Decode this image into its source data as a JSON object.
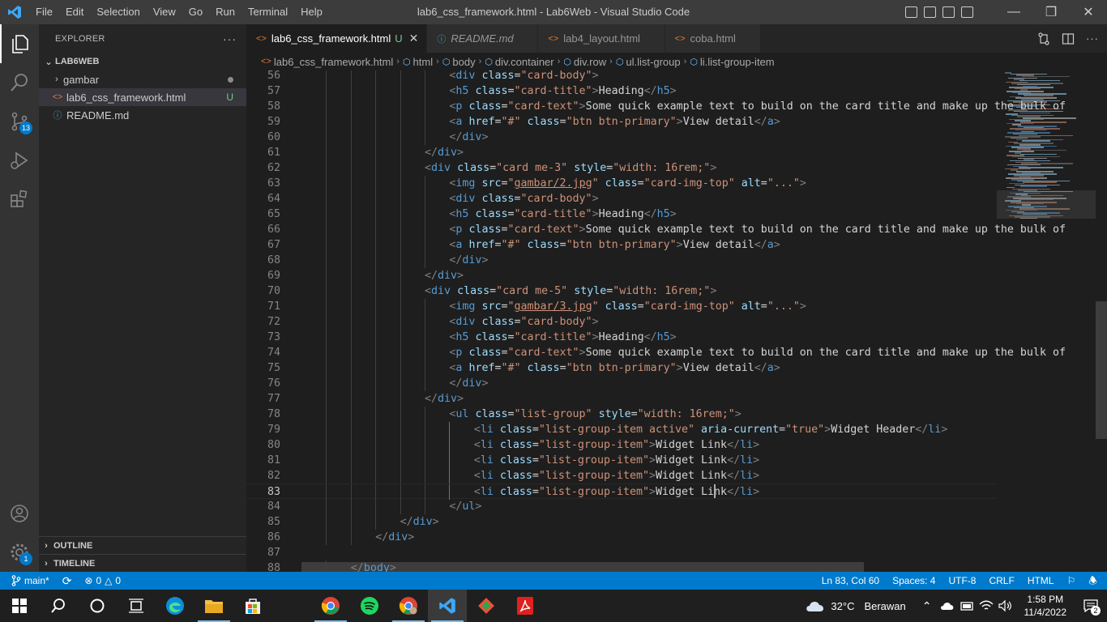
{
  "titlebar": {
    "menu": [
      "File",
      "Edit",
      "Selection",
      "View",
      "Go",
      "Run",
      "Terminal",
      "Help"
    ],
    "title": "lab6_css_framework.html - Lab6Web - Visual Studio Code"
  },
  "activitybar": {
    "source_control_badge": "13",
    "settings_badge": "1"
  },
  "sidebar": {
    "header": "EXPLORER",
    "folder": "LAB6WEB",
    "items": [
      {
        "label": "gambar",
        "type": "folder",
        "status": "dot"
      },
      {
        "label": "lab6_css_framework.html",
        "type": "html",
        "status": "U"
      },
      {
        "label": "README.md",
        "type": "info",
        "status": ""
      }
    ],
    "outline": "OUTLINE",
    "timeline": "TIMELINE"
  },
  "tabs": [
    {
      "label": "lab6_css_framework.html",
      "status": "U",
      "active": true,
      "icon": "html-icon"
    },
    {
      "label": "README.md",
      "status": "",
      "active": false,
      "icon": "info-icon"
    },
    {
      "label": "lab4_layout.html",
      "status": "",
      "active": false,
      "icon": "html-icon"
    },
    {
      "label": "coba.html",
      "status": "",
      "active": false,
      "icon": "html-icon"
    }
  ],
  "breadcrumb": [
    "lab6_css_framework.html",
    "html",
    "body",
    "div.container",
    "div.row",
    "ul.list-group",
    "li.list-group-item"
  ],
  "editor": {
    "current_line": 83,
    "lines": [
      {
        "n": "56",
        "indent": 6,
        "html": "<span class='tg'>&lt;</span><span class='tn'>div</span> <span class='at'>class</span><span class='tx'>=</span><span class='st'>\"card-body\"</span><span class='tg'>&gt;</span>"
      },
      {
        "n": "57",
        "indent": 6,
        "html": "<span class='tg'>&lt;</span><span class='tn'>h5</span> <span class='at'>class</span><span class='tx'>=</span><span class='st'>\"card-title\"</span><span class='tg'>&gt;</span><span class='tx'>Heading</span><span class='tg'>&lt;/</span><span class='tn'>h5</span><span class='tg'>&gt;</span>"
      },
      {
        "n": "58",
        "indent": 6,
        "html": "<span class='tg'>&lt;</span><span class='tn'>p</span> <span class='at'>class</span><span class='tx'>=</span><span class='st'>\"card-text\"</span><span class='tg'>&gt;</span><span class='tx'>Some quick example text to build on the card title and make up the bulk of</span>"
      },
      {
        "n": "59",
        "indent": 6,
        "html": "<span class='tg'>&lt;</span><span class='tn'>a</span> <span class='at'>href</span><span class='tx'>=</span><span class='st'>\"#\"</span> <span class='at'>class</span><span class='tx'>=</span><span class='st'>\"btn btn-primary\"</span><span class='tg'>&gt;</span><span class='tx'>View detail</span><span class='tg'>&lt;/</span><span class='tn'>a</span><span class='tg'>&gt;</span>"
      },
      {
        "n": "60",
        "indent": 6,
        "html": "<span class='tg'>&lt;/</span><span class='tn'>div</span><span class='tg'>&gt;</span>"
      },
      {
        "n": "61",
        "indent": 5,
        "html": "<span class='tg'>&lt;/</span><span class='tn'>div</span><span class='tg'>&gt;</span>"
      },
      {
        "n": "62",
        "indent": 5,
        "html": "<span class='tg'>&lt;</span><span class='tn'>div</span> <span class='at'>class</span><span class='tx'>=</span><span class='st'>\"card me-3\"</span> <span class='at'>style</span><span class='tx'>=</span><span class='st'>\"width: 16rem;\"</span><span class='tg'>&gt;</span>"
      },
      {
        "n": "63",
        "indent": 6,
        "html": "<span class='tg'>&lt;</span><span class='tn'>img</span> <span class='at'>src</span><span class='tx'>=</span><span class='st'>\"<span class='ul'>gambar/2.jpg</span>\"</span> <span class='at'>class</span><span class='tx'>=</span><span class='st'>\"card-img-top\"</span> <span class='at'>alt</span><span class='tx'>=</span><span class='st'>\"...\"</span><span class='tg'>&gt;</span>"
      },
      {
        "n": "64",
        "indent": 6,
        "html": "<span class='tg'>&lt;</span><span class='tn'>div</span> <span class='at'>class</span><span class='tx'>=</span><span class='st'>\"card-body\"</span><span class='tg'>&gt;</span>"
      },
      {
        "n": "65",
        "indent": 6,
        "html": "<span class='tg'>&lt;</span><span class='tn'>h5</span> <span class='at'>class</span><span class='tx'>=</span><span class='st'>\"card-title\"</span><span class='tg'>&gt;</span><span class='tx'>Heading</span><span class='tg'>&lt;/</span><span class='tn'>h5</span><span class='tg'>&gt;</span>"
      },
      {
        "n": "66",
        "indent": 6,
        "html": "<span class='tg'>&lt;</span><span class='tn'>p</span> <span class='at'>class</span><span class='tx'>=</span><span class='st'>\"card-text\"</span><span class='tg'>&gt;</span><span class='tx'>Some quick example text to build on the card title and make up the bulk of</span>"
      },
      {
        "n": "67",
        "indent": 6,
        "html": "<span class='tg'>&lt;</span><span class='tn'>a</span> <span class='at'>href</span><span class='tx'>=</span><span class='st'>\"#\"</span> <span class='at'>class</span><span class='tx'>=</span><span class='st'>\"btn btn-primary\"</span><span class='tg'>&gt;</span><span class='tx'>View detail</span><span class='tg'>&lt;/</span><span class='tn'>a</span><span class='tg'>&gt;</span>"
      },
      {
        "n": "68",
        "indent": 6,
        "html": "<span class='tg'>&lt;/</span><span class='tn'>div</span><span class='tg'>&gt;</span>"
      },
      {
        "n": "69",
        "indent": 5,
        "html": "<span class='tg'>&lt;/</span><span class='tn'>div</span><span class='tg'>&gt;</span>"
      },
      {
        "n": "70",
        "indent": 5,
        "html": "<span class='tg'>&lt;</span><span class='tn'>div</span> <span class='at'>class</span><span class='tx'>=</span><span class='st'>\"card me-5\"</span> <span class='at'>style</span><span class='tx'>=</span><span class='st'>\"width: 16rem;\"</span><span class='tg'>&gt;</span>"
      },
      {
        "n": "71",
        "indent": 6,
        "html": "<span class='tg'>&lt;</span><span class='tn'>img</span> <span class='at'>src</span><span class='tx'>=</span><span class='st'>\"<span class='ul'>gambar/3.jpg</span>\"</span> <span class='at'>class</span><span class='tx'>=</span><span class='st'>\"card-img-top\"</span> <span class='at'>alt</span><span class='tx'>=</span><span class='st'>\"...\"</span><span class='tg'>&gt;</span>"
      },
      {
        "n": "72",
        "indent": 6,
        "html": "<span class='tg'>&lt;</span><span class='tn'>div</span> <span class='at'>class</span><span class='tx'>=</span><span class='st'>\"card-body\"</span><span class='tg'>&gt;</span>"
      },
      {
        "n": "73",
        "indent": 6,
        "html": "<span class='tg'>&lt;</span><span class='tn'>h5</span> <span class='at'>class</span><span class='tx'>=</span><span class='st'>\"card-title\"</span><span class='tg'>&gt;</span><span class='tx'>Heading</span><span class='tg'>&lt;/</span><span class='tn'>h5</span><span class='tg'>&gt;</span>"
      },
      {
        "n": "74",
        "indent": 6,
        "html": "<span class='tg'>&lt;</span><span class='tn'>p</span> <span class='at'>class</span><span class='tx'>=</span><span class='st'>\"card-text\"</span><span class='tg'>&gt;</span><span class='tx'>Some quick example text to build on the card title and make up the bulk of</span>"
      },
      {
        "n": "75",
        "indent": 6,
        "html": "<span class='tg'>&lt;</span><span class='tn'>a</span> <span class='at'>href</span><span class='tx'>=</span><span class='st'>\"#\"</span> <span class='at'>class</span><span class='tx'>=</span><span class='st'>\"btn btn-primary\"</span><span class='tg'>&gt;</span><span class='tx'>View detail</span><span class='tg'>&lt;/</span><span class='tn'>a</span><span class='tg'>&gt;</span>"
      },
      {
        "n": "76",
        "indent": 6,
        "html": "<span class='tg'>&lt;/</span><span class='tn'>div</span><span class='tg'>&gt;</span>"
      },
      {
        "n": "77",
        "indent": 5,
        "html": "<span class='tg'>&lt;/</span><span class='tn'>div</span><span class='tg'>&gt;</span>"
      },
      {
        "n": "78",
        "indent": 6,
        "html": "<span class='tg'>&lt;</span><span class='tn'>ul</span> <span class='at'>class</span><span class='tx'>=</span><span class='st'>\"list-group\"</span> <span class='at'>style</span><span class='tx'>=</span><span class='st'>\"width: 16rem;\"</span><span class='tg'>&gt;</span>"
      },
      {
        "n": "79",
        "indent": 7,
        "html": "<span class='tg'>&lt;</span><span class='tn'>li</span> <span class='at'>class</span><span class='tx'>=</span><span class='st'>\"list-group-item active\"</span> <span class='at'>aria-current</span><span class='tx'>=</span><span class='st'>\"true\"</span><span class='tg'>&gt;</span><span class='tx'>Widget Header</span><span class='tg'>&lt;/</span><span class='tn'>li</span><span class='tg'>&gt;</span>"
      },
      {
        "n": "80",
        "indent": 7,
        "html": "<span class='tg'>&lt;</span><span class='tn'>li</span> <span class='at'>class</span><span class='tx'>=</span><span class='st'>\"list-group-item\"</span><span class='tg'>&gt;</span><span class='tx'>Widget Link</span><span class='tg'>&lt;/</span><span class='tn'>li</span><span class='tg'>&gt;</span>"
      },
      {
        "n": "81",
        "indent": 7,
        "html": "<span class='tg'>&lt;</span><span class='tn'>li</span> <span class='at'>class</span><span class='tx'>=</span><span class='st'>\"list-group-item\"</span><span class='tg'>&gt;</span><span class='tx'>Widget Link</span><span class='tg'>&lt;/</span><span class='tn'>li</span><span class='tg'>&gt;</span>"
      },
      {
        "n": "82",
        "indent": 7,
        "html": "<span class='tg'>&lt;</span><span class='tn'>li</span> <span class='at'>class</span><span class='tx'>=</span><span class='st'>\"list-group-item\"</span><span class='tg'>&gt;</span><span class='tx'>Widget Link</span><span class='tg'>&lt;/</span><span class='tn'>li</span><span class='tg'>&gt;</span>"
      },
      {
        "n": "83",
        "indent": 7,
        "html": "<span class='tg'>&lt;</span><span class='tn'>li</span> <span class='at'>class</span><span class='tx'>=</span><span class='st'>\"list-group-item\"</span><span class='tg'>&gt;</span><span class='tx'>Widget Link</span><span class='tg'>&lt;/</span><span class='tn'>li</span><span class='tg'>&gt;</span>"
      },
      {
        "n": "84",
        "indent": 6,
        "html": "<span class='tg'>&lt;/</span><span class='tn'>ul</span><span class='tg'>&gt;</span>"
      },
      {
        "n": "85",
        "indent": 4,
        "html": "<span class='tg'>&lt;/</span><span class='tn'>div</span><span class='tg'>&gt;</span>"
      },
      {
        "n": "86",
        "indent": 3,
        "html": "<span class='tg'>&lt;/</span><span class='tn'>div</span><span class='tg'>&gt;</span>"
      },
      {
        "n": "87",
        "indent": 0,
        "html": ""
      },
      {
        "n": "88",
        "indent": 2,
        "html": "<span class='tg'>&lt;/</span><span class='tn'>body</span><span class='tg'>&gt;</span>"
      }
    ]
  },
  "statusbar": {
    "branch": "main*",
    "sync": "",
    "errors": "0",
    "warnings": "0",
    "position": "Ln 83, Col 60",
    "spaces": "Spaces: 4",
    "encoding": "UTF-8",
    "eol": "CRLF",
    "language": "HTML"
  },
  "taskbar": {
    "weather_temp": "32°C",
    "weather_desc": "Berawan",
    "time": "1:58 PM",
    "date": "11/4/2022",
    "notification_count": "2"
  },
  "colors": {
    "accent": "#007acc",
    "tag": "#569cd6",
    "attribute": "#9cdcfe",
    "string": "#ce9178",
    "untracked": "#73c991"
  }
}
